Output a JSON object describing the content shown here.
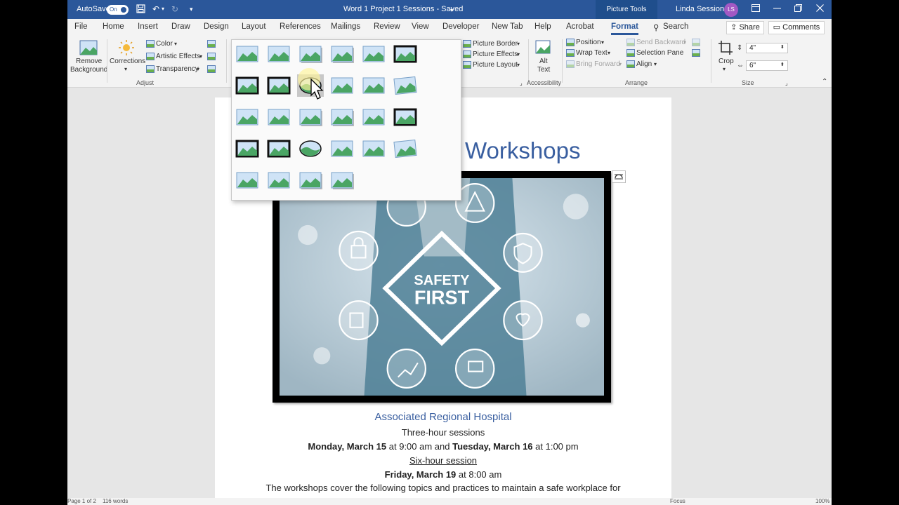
{
  "titlebar": {
    "autosave_label": "AutoSave",
    "autosave_state": "On",
    "doc_title": "Word 1 Project 1 Sessions  -  Saved",
    "context_tab": "Picture Tools",
    "user_name": "Linda Sessions",
    "user_initials": "LS",
    "colors": {
      "bar": "#2b579a",
      "context": "#1f4e8c",
      "avatar": "#a259c4"
    }
  },
  "tabs": [
    "File",
    "Home",
    "Insert",
    "Draw",
    "Design",
    "Layout",
    "References",
    "Mailings",
    "Review",
    "View",
    "Developer",
    "New Tab",
    "Help",
    "Acrobat",
    "Format"
  ],
  "active_tab": "Format",
  "search_label": "Search",
  "share_label": "Share",
  "comments_label": "Comments",
  "ribbon": {
    "adjust": {
      "remove_background": [
        "Remove",
        "Background"
      ],
      "corrections": "Corrections",
      "color": "Color",
      "artistic_effects": "Artistic Effects",
      "transparency": "Transparency",
      "group_label": "Adjust"
    },
    "picture_styles": {
      "picture_border": "Picture Border",
      "picture_effects": "Picture Effects",
      "picture_layout": "Picture Layout"
    },
    "accessibility": {
      "alt_text": [
        "Alt",
        "Text"
      ],
      "group_label": "Accessibility"
    },
    "arrange": {
      "position": "Position",
      "wrap_text": "Wrap Text",
      "bring_forward": "Bring Forward",
      "send_backward": "Send Backward",
      "selection_pane": "Selection Pane",
      "align": "Align",
      "group_label": "Arrange"
    },
    "size": {
      "crop": "Crop",
      "height": "4\"",
      "width": "6\"",
      "group_label": "Size"
    }
  },
  "document": {
    "heading": "Workshops",
    "hospital": "Associated Regional Hospital",
    "three_hour": "Three-hour sessions",
    "mon_day": "Monday, March 15",
    "mon_time": "at 9:00 am and",
    "tue_day": "Tuesday, March 16",
    "tue_time": "at 1:00 pm",
    "six_hour": "Six-hour session",
    "fri_day": "Friday, March 19",
    "fri_time": "at 8:00 am",
    "body_line": "The workshops cover the following topics and practices to maintain a safe workplace for",
    "image_text": [
      "SAFETY",
      "FIRST"
    ],
    "heading_color": "#3a5fa0"
  },
  "gallery": {
    "rows": 5,
    "columns": 6,
    "style_count": 28,
    "hover_index": 8
  },
  "status": {
    "page": "Page 1 of 2",
    "words": "116 words",
    "focus": "Focus",
    "zoom": "100%"
  }
}
